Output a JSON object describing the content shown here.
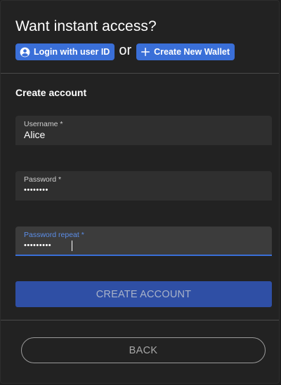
{
  "header": {
    "title": "Want instant access?",
    "login_button_label": "Login with user ID",
    "or_text": "or",
    "create_wallet_button_label": "Create New Wallet"
  },
  "form": {
    "section_title": "Create account",
    "username": {
      "label": "Username *",
      "value": "Alice"
    },
    "password": {
      "label": "Password *",
      "value": "••••••••"
    },
    "password_repeat": {
      "label": "Password repeat *",
      "value": "•••••••••"
    },
    "submit_label": "CREATE ACCOUNT"
  },
  "footer": {
    "back_label": "BACK"
  },
  "icons": {
    "login": "account-circle-icon",
    "create": "plus-icon"
  },
  "colors": {
    "accent": "#3a6fd8",
    "submit_background": "#2f4fa5",
    "background": "#222222",
    "field_background": "#2f2f2f"
  }
}
